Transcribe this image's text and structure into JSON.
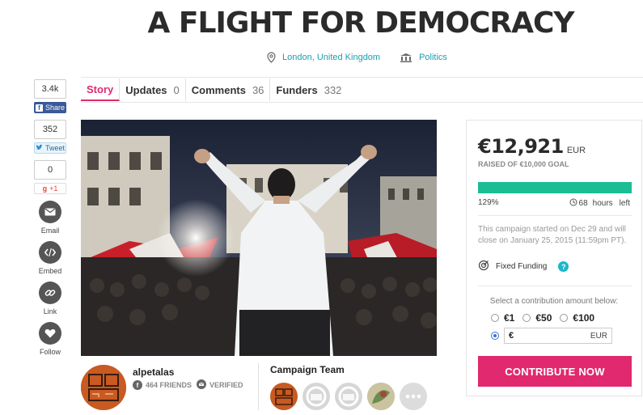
{
  "campaign": {
    "title": "A FLIGHT FOR DEMOCRACY",
    "location": "London, United Kingdom",
    "category": "Politics"
  },
  "tabs": [
    {
      "label": "Story",
      "count": "",
      "active": true
    },
    {
      "label": "Updates",
      "count": "0",
      "active": false
    },
    {
      "label": "Comments",
      "count": "36",
      "active": false
    },
    {
      "label": "Funders",
      "count": "332",
      "active": false
    }
  ],
  "social": {
    "facebook_count": "3.4k",
    "facebook_label": "Share",
    "twitter_count": "352",
    "twitter_label": "Tweet",
    "gplus_count": "0",
    "gplus_label": "+1",
    "email_label": "Email",
    "embed_label": "Embed",
    "link_label": "Link",
    "follow_label": "Follow"
  },
  "owner": {
    "name": "alpetalas",
    "friends": "464 FRIENDS",
    "verified": "VERIFIED"
  },
  "team": {
    "title": "Campaign Team"
  },
  "funding": {
    "raised": "€12,921",
    "currency": "EUR",
    "goal_text": "RAISED OF €10,000 GOAL",
    "percent_text": "129%",
    "percent_value": 129,
    "time_value": "68",
    "time_unit": "hours",
    "time_suffix": "left",
    "note": "This campaign started on Dec 29 and will close on January 25, 2015 (11:59pm PT).",
    "funding_type": "Fixed Funding",
    "help": "?",
    "select_label": "Select a contribution amount below:",
    "options": [
      "€1",
      "€50",
      "€100"
    ],
    "custom_symbol": "€",
    "custom_currency": "EUR",
    "cta": "CONTRIBUTE NOW"
  },
  "colors": {
    "accent": "#e0296e",
    "link": "#1a9fb0",
    "progress": "#1cbc94"
  }
}
